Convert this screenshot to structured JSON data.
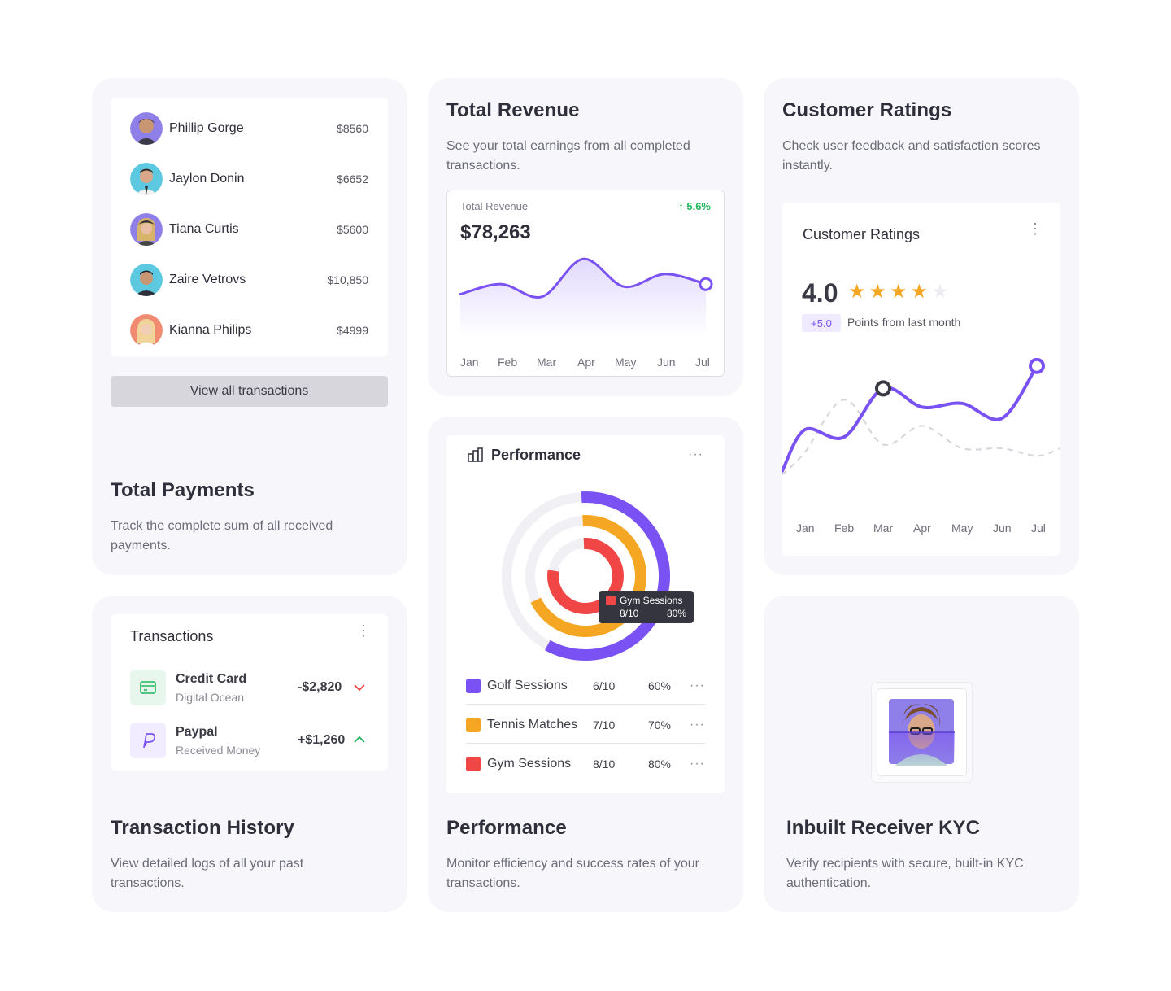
{
  "payments_card": {
    "rows": [
      {
        "name": "Phillip Gorge",
        "amount": "$8560"
      },
      {
        "name": "Jaylon Donin",
        "amount": "$6652"
      },
      {
        "name": "Tiana Curtis",
        "amount": "$5600"
      },
      {
        "name": "Zaire Vetrovs",
        "amount": "$10,850"
      },
      {
        "name": "Kianna Philips",
        "amount": "$4999"
      }
    ],
    "button_label": "View all transactions",
    "title": "Total Payments",
    "description": "Track the complete sum of all received payments."
  },
  "revenue_card": {
    "title": "Total Revenue",
    "description": "See your total earnings from all completed transactions.",
    "widget_label": "Total Revenue",
    "change": "↑ 5.6%",
    "value": "$78,263",
    "accent": "#7a52f4"
  },
  "ratings_card": {
    "title": "Customer Ratings",
    "description": "Check user feedback and satisfaction scores instantly.",
    "widget_title": "Customer Ratings",
    "score": "4.0",
    "stars_filled": 4,
    "stars_total": 5,
    "badge": "+5.0",
    "note": "Points from last month"
  },
  "performance_card": {
    "widget_title": "Performance",
    "title": "Performance",
    "description": "Monitor efficiency and success rates of your transactions.",
    "tooltip": {
      "name": "Gym Sessions",
      "score": "8/10",
      "pct": "80%"
    },
    "legend": [
      {
        "name": "Golf Sessions",
        "score": "6/10",
        "pct": "60%",
        "color": "#7a52f4"
      },
      {
        "name": "Tennis Matches",
        "score": "7/10",
        "pct": "70%",
        "color": "#f5a623"
      },
      {
        "name": "Gym Sessions",
        "score": "8/10",
        "pct": "80%",
        "color": "#f04646"
      }
    ],
    "more": "···"
  },
  "transactions_card": {
    "widget_title": "Transactions",
    "items": [
      {
        "name": "Credit Card",
        "sub": "Digital Ocean",
        "amount": "-$2,820",
        "direction": "down",
        "color": "#f04646"
      },
      {
        "name": "Paypal",
        "sub": "Received Money",
        "amount": "+$1,260",
        "direction": "up",
        "color": "#22b55e"
      }
    ],
    "title": "Transaction History",
    "description": "View detailed logs of all your past transactions."
  },
  "kyc_card": {
    "title": "Inbuilt Receiver KYC",
    "description": "Verify recipients with secure, built-in KYC authentication."
  },
  "chart_data": [
    {
      "type": "area",
      "categories": [
        "Jan",
        "Feb",
        "Mar",
        "Apr",
        "May",
        "Jun",
        "Jul"
      ],
      "series": [
        {
          "values": [
            62000,
            66000,
            61000,
            76000,
            65000,
            70000,
            66000
          ]
        }
      ]
    },
    {
      "type": "line",
      "categories": [
        "Jan",
        "Feb",
        "Mar",
        "Apr",
        "May",
        "Jun",
        "Jul"
      ],
      "series": [
        {
          "values": [
            2.0,
            1.8,
            3.1,
            2.6,
            2.7,
            2.3,
            3.7
          ]
        },
        {
          "values": [
            1.4,
            2.8,
            1.6,
            2.1,
            1.5,
            1.5,
            1.3
          ]
        }
      ]
    },
    {
      "type": "pie",
      "categories": [
        "Golf Sessions",
        "Tennis Matches",
        "Gym Sessions"
      ],
      "values": [
        60,
        70,
        80
      ]
    }
  ]
}
